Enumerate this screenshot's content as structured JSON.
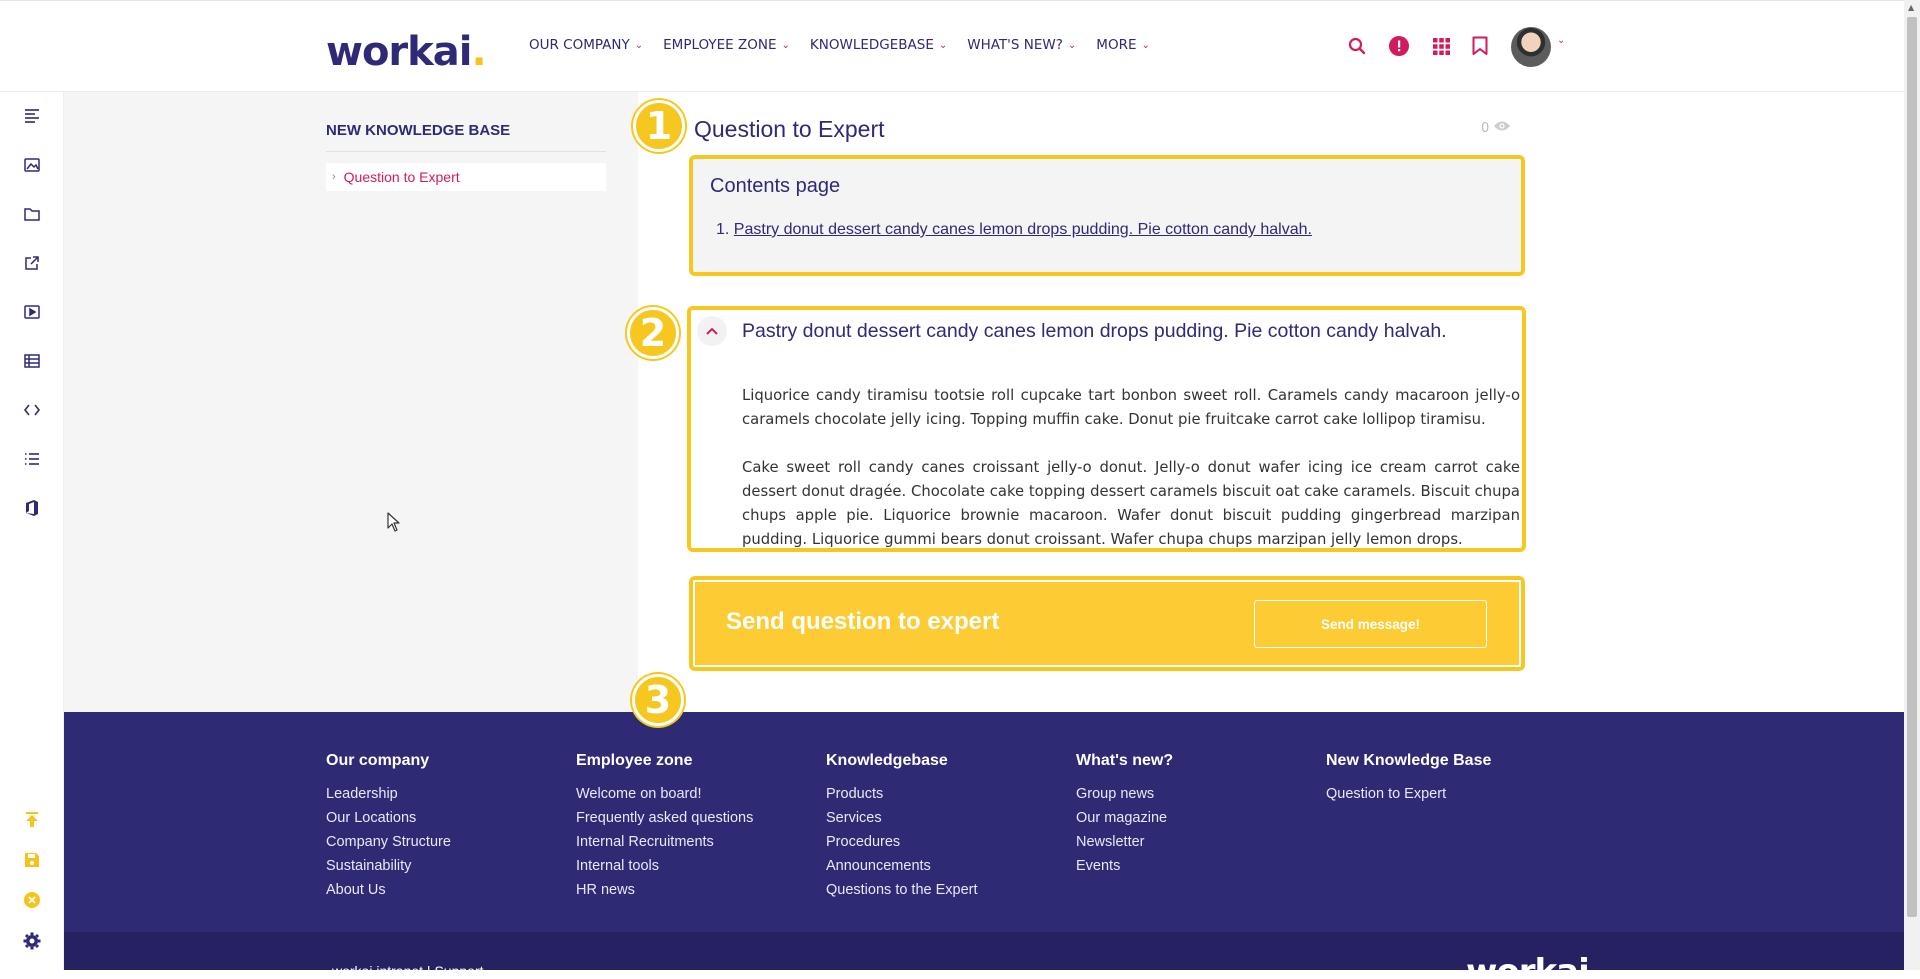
{
  "header": {
    "logo_text": "workai",
    "logo_dot": ".",
    "nav": [
      {
        "label": "OUR COMPANY"
      },
      {
        "label": "EMPLOYEE ZONE"
      },
      {
        "label": "KNOWLEDGEBASE"
      },
      {
        "label": "WHAT'S NEW?"
      },
      {
        "label": "MORE"
      }
    ],
    "icons": [
      "search-icon",
      "alert-icon",
      "apps-grid-icon",
      "bookmark-icon"
    ]
  },
  "rail_icons": [
    "text-align-icon",
    "image-icon",
    "folder-icon",
    "external-link-icon",
    "video-icon",
    "table-icon",
    "code-icon",
    "list-icon",
    "office-icon",
    "upload-icon",
    "save-icon",
    "close-circle-icon",
    "settings-icon"
  ],
  "sidebar": {
    "title": "NEW KNOWLEDGE BASE",
    "items": [
      {
        "label": "Question to Expert"
      }
    ]
  },
  "main": {
    "title": "Question to Expert",
    "views": "0",
    "badges": [
      "1",
      "2",
      "3"
    ],
    "contents": {
      "title": "Contents page",
      "items": [
        "1.",
        "Pastry donut dessert candy canes lemon drops pudding. Pie cotton candy halvah."
      ]
    },
    "article": {
      "title": "Pastry donut dessert candy canes lemon drops pudding. Pie cotton candy halvah.",
      "paragraphs": [
        "Liquorice candy tiramisu tootsie roll cupcake tart bonbon sweet roll. Caramels candy macaroon jelly-o caramels chocolate jelly icing. Topping muffin cake. Donut pie fruitcake carrot cake lollipop tiramisu.",
        "Cake sweet roll candy canes croissant jelly-o donut. Jelly-o donut wafer icing ice cream carrot cake dessert donut dragée. Chocolate cake topping dessert caramels biscuit oat cake caramels. Biscuit chupa chups apple pie. Liquorice brownie macaroon. Wafer donut biscuit pudding gingerbread marzipan pudding. Liquorice gummi bears donut croissant. Wafer chupa chups marzipan jelly lemon drops."
      ]
    },
    "cta": {
      "title": "Send question to expert",
      "button": "Send message!"
    }
  },
  "footer": {
    "columns": [
      {
        "title": "Our company",
        "links": [
          "Leadership",
          "Our Locations",
          "Company Structure",
          "Sustainability",
          "About Us"
        ]
      },
      {
        "title": "Employee zone",
        "links": [
          "Welcome on board!",
          "Frequently asked questions",
          "Internal Recruitments",
          "Internal tools",
          "HR news"
        ]
      },
      {
        "title": "Knowledgebase",
        "links": [
          "Products",
          "Services",
          "Procedures",
          "Announcements",
          "Questions to the Expert"
        ]
      },
      {
        "title": "What's new?",
        "links": [
          "Group news",
          "Our magazine",
          "Newsletter",
          "Events"
        ]
      },
      {
        "title": "New Knowledge Base",
        "links": [
          "Question to Expert"
        ]
      }
    ],
    "bottom_left": "workai intranet   |   Support",
    "bottom_logo": "workai"
  },
  "colors": {
    "brand": "#2e2a78",
    "accent": "#d21b5e",
    "highlight": "#f6c71f",
    "footer": "#2e2a74"
  }
}
